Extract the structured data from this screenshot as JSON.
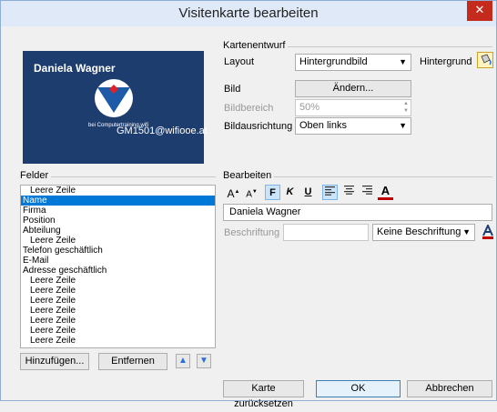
{
  "window": {
    "title": "Visitenkarte bearbeiten",
    "close_glyph": "✕"
  },
  "card": {
    "name": "Daniela Wagner",
    "company": "bei Computertraining.wifi",
    "email": "GM1501@wifiooe.at",
    "bg_color": "#1d3d6e"
  },
  "kartenentwurf": {
    "group_label": "Kartenentwurf",
    "layout_label": "Layout",
    "layout_value": "Hintergrundbild",
    "hintergrund_label": "Hintergrund",
    "bild_label": "Bild",
    "aendern_button": "Ändern...",
    "bildbereich_label": "Bildbereich",
    "bildbereich_value": "50%",
    "bildausrichtung_label": "Bildausrichtung",
    "bildausrichtung_value": "Oben links"
  },
  "felder": {
    "group_label": "Felder",
    "items": [
      {
        "label": "Leere Zeile",
        "indent": true,
        "selected": false
      },
      {
        "label": "Name",
        "indent": false,
        "selected": true
      },
      {
        "label": "Firma",
        "indent": false,
        "selected": false
      },
      {
        "label": "Position",
        "indent": false,
        "selected": false
      },
      {
        "label": "Abteilung",
        "indent": false,
        "selected": false
      },
      {
        "label": "Leere Zeile",
        "indent": true,
        "selected": false
      },
      {
        "label": "Telefon geschäftlich",
        "indent": false,
        "selected": false
      },
      {
        "label": "E-Mail",
        "indent": false,
        "selected": false
      },
      {
        "label": "Adresse geschäftlich",
        "indent": false,
        "selected": false
      },
      {
        "label": "Leere Zeile",
        "indent": true,
        "selected": false
      },
      {
        "label": "Leere Zeile",
        "indent": true,
        "selected": false
      },
      {
        "label": "Leere Zeile",
        "indent": true,
        "selected": false
      },
      {
        "label": "Leere Zeile",
        "indent": true,
        "selected": false
      },
      {
        "label": "Leere Zeile",
        "indent": true,
        "selected": false
      },
      {
        "label": "Leere Zeile",
        "indent": true,
        "selected": false
      },
      {
        "label": "Leere Zeile",
        "indent": true,
        "selected": false
      }
    ],
    "add_button": "Hinzufügen...",
    "remove_button": "Entfernen"
  },
  "bearbeiten": {
    "group_label": "Bearbeiten",
    "toolbar": {
      "grow_font": "A",
      "shrink_font": "A",
      "bold": "F",
      "italic": "K",
      "underline": "U",
      "font_color": "A"
    },
    "text_value": "Daniela Wagner",
    "beschriftung_label": "Beschriftung",
    "beschriftung_value": "",
    "beschriftung_position": "Keine Beschriftung"
  },
  "footer": {
    "reset_button": "Karte zurücksetzen",
    "ok_button": "OK",
    "cancel_button": "Abbrechen"
  },
  "colors": {
    "accent": "#0078d7",
    "title_bar": "#dfe9f7",
    "close": "#c42b1c",
    "font_color_underline": "#c00000"
  }
}
